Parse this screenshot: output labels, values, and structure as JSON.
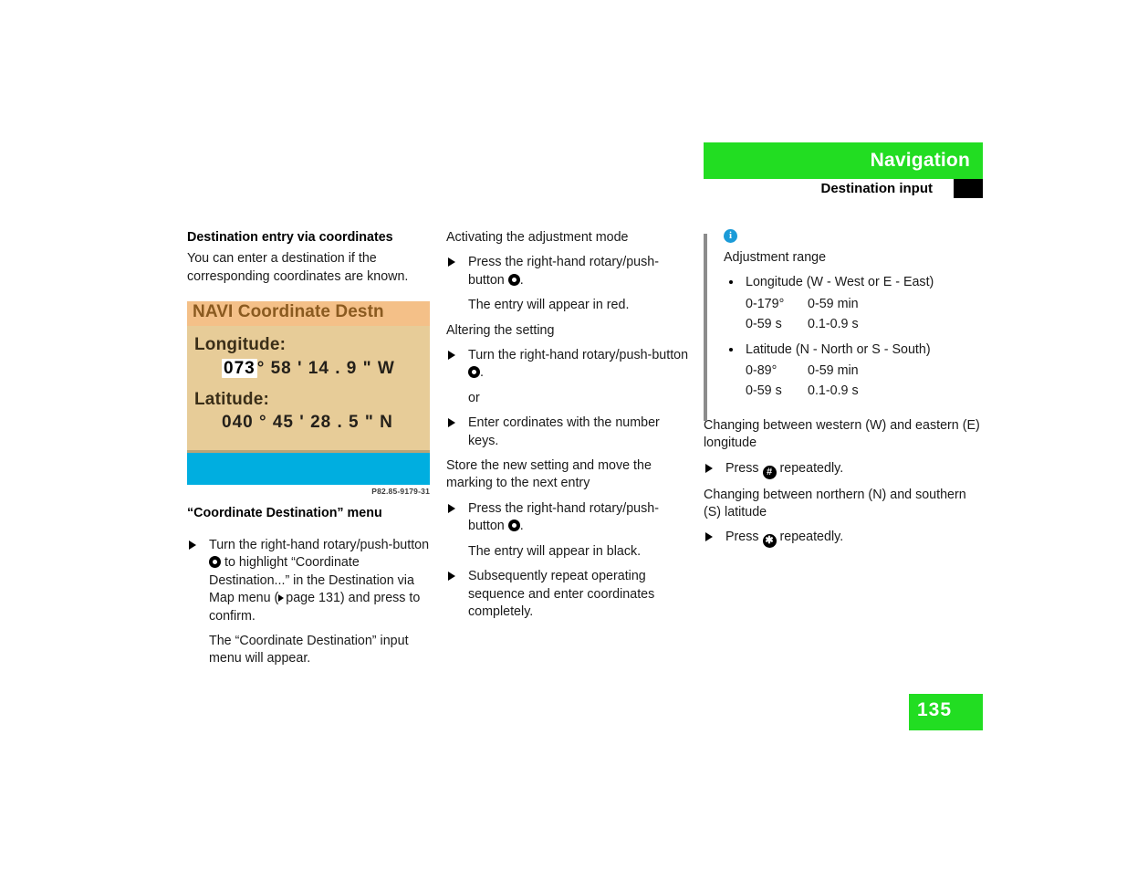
{
  "header": {
    "title": "Navigation",
    "subtitle": "Destination input",
    "band_color": "#22dd22"
  },
  "left_column": {
    "section_heading": "Destination entry via coordinates",
    "intro": "You can enter a destination if the corresponding coordinates are known.",
    "figure": {
      "screen_title": "NAVI Coordinate Destn",
      "longitude_label": "Longitude:",
      "longitude_highlight": "073",
      "longitude_rest": "° 58 ' 14 . 9 \" W",
      "latitude_label": "Latitude:",
      "latitude_value": "040 ° 45 ' 28 . 5 \" N",
      "code": "P82.85-9179-31"
    },
    "figure_caption": "“Coordinate Destination” menu",
    "step1_part1": "Turn the right-hand rotary/push-button",
    "step1_part2": "to highlight “Coordinate Destination...” in the Destination via Map menu (",
    "step1_pageref": "page 131",
    "step1_part3": ") and press to confirm.",
    "step1_result": "The “Coordinate Destination” input menu will appear."
  },
  "middle_column": {
    "heading1": "Activating the adjustment mode",
    "step1_text": "Press the right-hand rotary/push-button",
    "step1_after": ".",
    "step1_result": "The entry will appear in red.",
    "heading2": "Altering the setting",
    "step2_text": "Turn the right-hand rotary/push-button",
    "step2_after": ".",
    "or": "or",
    "step3_text": "Enter cordinates with the number keys.",
    "heading3": "Store the new setting and move the marking to the next entry",
    "step4_text": "Press the right-hand rotary/push-button",
    "step4_after": ".",
    "step4_result": "The entry will appear in black.",
    "step5_text": "Subsequently repeat operating sequence and enter coordinates completely."
  },
  "right_column": {
    "info_icon": "i",
    "info_heading": "Adjustment range",
    "bullets": [
      {
        "label": "Longitude (W - West or E - East)",
        "rows": [
          {
            "c1": "0-179°",
            "c2": "0-59 min"
          },
          {
            "c1": "0-59 s",
            "c2": "0.1-0.9 s"
          }
        ]
      },
      {
        "label": "Latitude (N - North or S - South)",
        "rows": [
          {
            "c1": "0-89°",
            "c2": "0-59 min"
          },
          {
            "c1": "0-59 s",
            "c2": "0.1-0.9 s"
          }
        ]
      }
    ],
    "heading_longitude": "Changing between western (W) and eastern (E) longitude",
    "step_hash_before": "Press",
    "step_hash_icon": "#",
    "step_hash_after": "repeatedly.",
    "heading_latitude": "Changing between northern (N) and southern (S) latitude",
    "step_star_before": "Press",
    "step_star_icon": "✱",
    "step_star_after": "repeatedly."
  },
  "footer": {
    "page_number": "135"
  }
}
